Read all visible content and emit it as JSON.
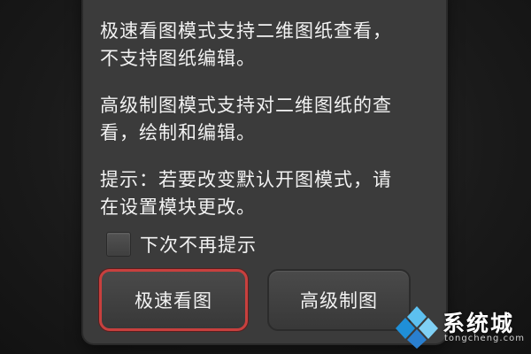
{
  "dialog": {
    "message_lines": [
      "极速看图模式支持二维图纸查看，",
      "不支持图纸编辑。",
      "高级制图模式支持对二维图纸的查",
      "看，绘制和编辑。",
      "提示：若要改变默认开图模式，请",
      "在设置模块更改。"
    ],
    "checkbox": {
      "label": "下次不再提示",
      "checked": false
    },
    "buttons": {
      "quick_view": "极速看图",
      "advanced_draw": "高级制图"
    },
    "selected_button_color": "#c8403e"
  },
  "watermark": {
    "name": "系统城",
    "domain": "tongcheng.com",
    "logo_colors": [
      "#1f8fd8",
      "#5cc0f0",
      "#2a7fcf",
      "#7fd0f5"
    ]
  }
}
